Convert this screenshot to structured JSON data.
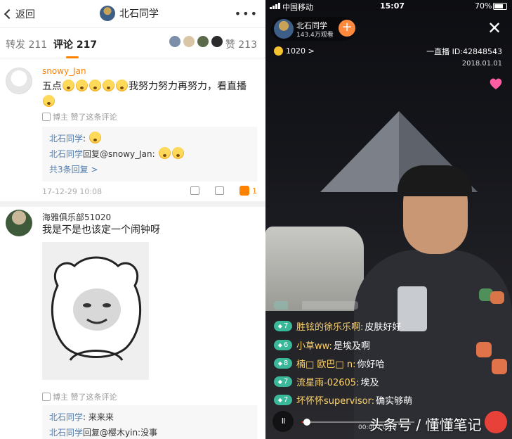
{
  "left": {
    "header": {
      "back_label": "返回",
      "title": "北石同学",
      "more_glyph": "•••"
    },
    "tabs": {
      "repost": "转发 211",
      "comments": "评论 217",
      "likes": "赞 213"
    },
    "comment1": {
      "author": "snowy_Jan",
      "text_prefix": "五点",
      "text_suffix": "我努力努力再努力，看直播",
      "liked_by": "博主 赞了这条评论",
      "replies": [
        {
          "name": "北石同学",
          "text": ":"
        },
        {
          "name": "北石同学",
          "text": "回复@snowy_Jan:"
        }
      ],
      "more_replies": "共3条回复 >",
      "date": "17-12-29 10:08",
      "like_count": "1"
    },
    "comment2": {
      "author": "海雅俱乐部51020",
      "text": "我是不是也该定一个闹钟呀",
      "liked_by": "博主 赞了这条评论",
      "replies": [
        {
          "name": "北石同学",
          "text": ": 来来来"
        },
        {
          "name": "北石同学",
          "text": "回复@樱木yin:没事"
        }
      ]
    }
  },
  "right": {
    "status": {
      "carrier": "中国移动",
      "time": "15:07",
      "battery": "70%"
    },
    "host": {
      "name": "北石同学",
      "viewers": "143.4万观看"
    },
    "follow_glyph": "+",
    "close_glyph": "✕",
    "coins": "1020 >",
    "live_id": "一直播 ID:42848543",
    "date": "2018.01.01",
    "danmaku": [
      {
        "level": "7",
        "level_color": "#3bb79a",
        "user": "胜铉的徐乐乐啊:",
        "msg": "皮肤好好"
      },
      {
        "level": "6",
        "level_color": "#3bb79a",
        "user": "小草ww:",
        "msg": "是埃及啊"
      },
      {
        "level": "8",
        "level_color": "#3bb79a",
        "user": "楠□ 欧巴□ n:",
        "msg": "你好哈"
      },
      {
        "level": "7",
        "level_color": "#3bb79a",
        "user": "流星雨-02605:",
        "msg": "埃及"
      },
      {
        "level": "7",
        "level_color": "#3bb79a",
        "user": "坏怀怀supervisor:",
        "msg": "确实够萌"
      }
    ],
    "player": {
      "pause_glyph": "II",
      "time": "00:00 / 02:0"
    },
    "watermark": "头条号 / 懂懂笔记"
  },
  "colors": {
    "accent_orange": "#ff8200",
    "link_blue": "#507daf",
    "danmaku_user": "#ffd36a"
  }
}
